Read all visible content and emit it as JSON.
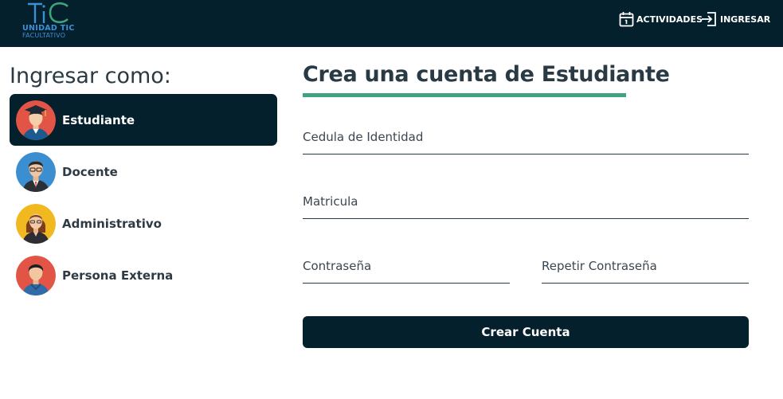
{
  "header": {
    "logo": {
      "line1": "UNIDAD TIC",
      "line2": "FACULTATIVO",
      "mark": "TiC"
    },
    "nav": [
      {
        "label": "ACTIVIDADES",
        "icon": "calendar-icon"
      },
      {
        "label": "INGRESAR",
        "icon": "login-icon"
      }
    ]
  },
  "sidebar": {
    "title": "Ingresar como:",
    "roles": [
      {
        "label": "Estudiante",
        "avatar": "student-avatar",
        "active": true
      },
      {
        "label": "Docente",
        "avatar": "teacher-avatar",
        "active": false
      },
      {
        "label": "Administrativo",
        "avatar": "admin-avatar",
        "active": false
      },
      {
        "label": "Persona Externa",
        "avatar": "external-avatar",
        "active": false
      }
    ]
  },
  "form": {
    "title": "Crea una cuenta de Estudiante",
    "fields": {
      "cedula": {
        "placeholder": "Cedula de Identidad",
        "value": ""
      },
      "matricula": {
        "placeholder": "Matricula",
        "value": ""
      },
      "password": {
        "placeholder": "Contraseña",
        "value": ""
      },
      "repeat_password": {
        "placeholder": "Repetir Contraseña",
        "value": ""
      }
    },
    "submit_label": "Crear Cuenta"
  },
  "colors": {
    "navbar": "#03202c",
    "accent_underline": "#3ea37e",
    "logo_blue": "#3d8fd6",
    "text": "#2a3a44"
  }
}
